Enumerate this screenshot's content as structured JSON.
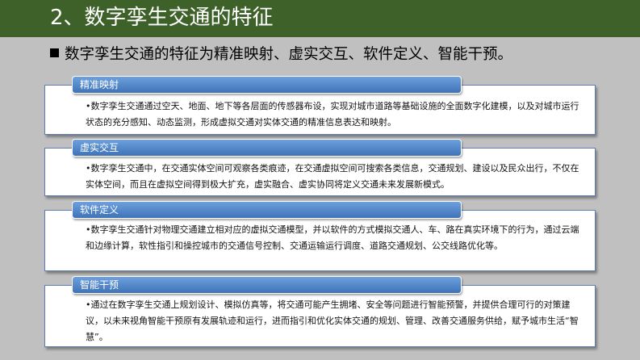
{
  "header": {
    "title": "2、数字孪生交通的特征"
  },
  "subtitle": "数字孪生交通的特征为精准映射、虚实交互、软件定义、智能干预。",
  "sections": [
    {
      "label": "精准映射",
      "body": "•数字孪生交通通过空天、地面、地下等各层面的传感器布设，实现对城市道路等基础设施的全面数字化建模，以及对城市运行状态的充分感知、动态监测，形成虚拟交通对实体交通的精准信息表达和映射。"
    },
    {
      "label": "虚实交互",
      "body": "•数字孪生交通中，在交通实体空间可观察各类痕迹，在交通虚拟空间可搜索各类信息，交通规划、建设以及民众出行，不仅在实体空间，而且在虚拟空间得到极大扩充，虚实融合、虚实协同将定义交通未来发展新模式。"
    },
    {
      "label": "软件定义",
      "body": "•数字孪生交通针对物理交通建立相对应的虚拟交通模型，并以软件的方式模拟交通人、车、路在真实环境下的行为，通过云端和边缘计算，软性指引和操控城市的交通信号控制、交通运输运行调度、道路交通规划、公交线路优化等。"
    },
    {
      "label": "智能干预",
      "body": "•通过在数字孪生交通上规划设计、模拟仿真等，将交通可能产生拥堵、安全等问题进行智能预警，并提供合理可行的对策建议，以未来视角智能干预原有发展轨迹和运行，进而指引和优化实体交通的规划、管理、改善交通服务供给，赋予城市生活“智慧”。"
    }
  ],
  "colors": {
    "title_bar": "#3d6128",
    "background": "#c0c0c0",
    "tab_fill": "#4f86c6",
    "card_border": "#5e7bb4"
  }
}
